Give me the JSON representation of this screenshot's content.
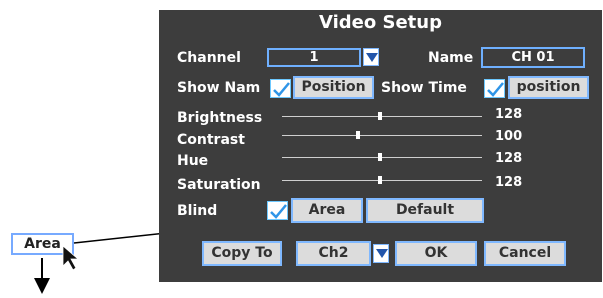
{
  "dialog": {
    "title": "Video Setup",
    "channel_label": "Channel",
    "channel_value": "1",
    "name_label": "Name",
    "name_value": "CH 01",
    "show_name_label": "Show Nam",
    "show_name_checked": true,
    "show_name_position_button": "Position",
    "show_time_label": "Show Time",
    "show_time_checked": true,
    "show_time_position_button": "position",
    "sliders": [
      {
        "label": "Brightness",
        "value": "128",
        "level": 0.5
      },
      {
        "label": "Contrast",
        "value": "100",
        "level": 0.4
      },
      {
        "label": "Hue",
        "value": "128",
        "level": 0.5
      },
      {
        "label": "Saturation",
        "value": "128",
        "level": 0.5
      }
    ],
    "blind_label": "Blind",
    "blind_checked": true,
    "area_button": "Area",
    "default_button": "Default",
    "copy_to_button": "Copy To",
    "copy_target_value": "Ch2",
    "ok_button": "OK",
    "cancel_button": "Cancel"
  },
  "annotation": {
    "area_callout_label": "Area"
  },
  "icons": [
    "dropdown-arrow-icon",
    "checkmark-icon",
    "cursor-arrow-icon",
    "down-arrow-icon"
  ]
}
